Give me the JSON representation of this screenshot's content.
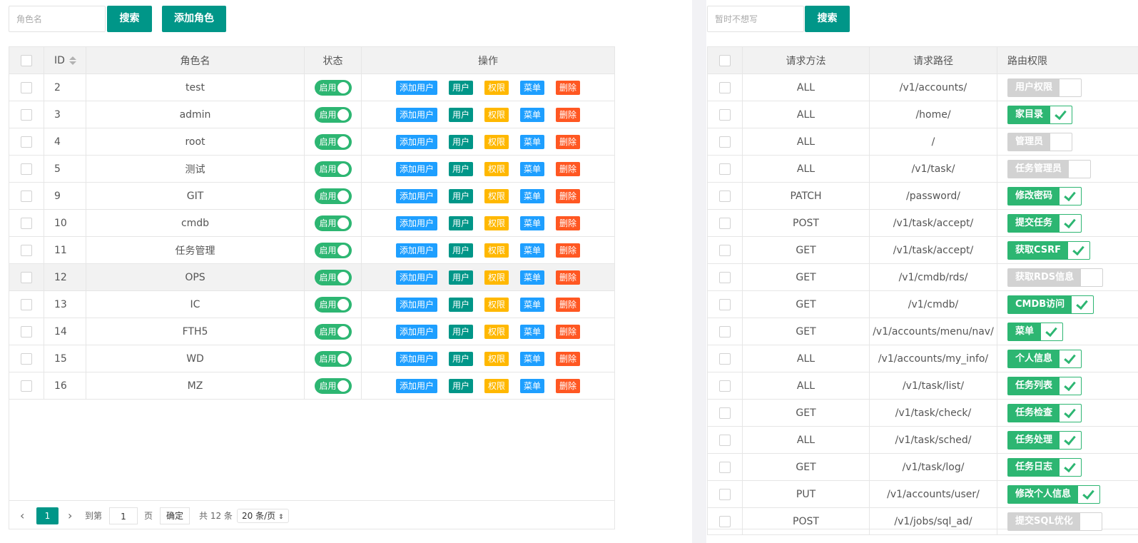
{
  "left": {
    "search_placeholder": "角色名",
    "search_button": "搜索",
    "add_button": "添加角色",
    "columns": {
      "id": "ID",
      "name": "角色名",
      "status": "状态",
      "ops": "操作"
    },
    "status_label": "启用",
    "op_labels": {
      "add_user": "添加用户",
      "user": "用户",
      "perm": "权限",
      "menu": "菜单",
      "delete": "删除"
    },
    "rows": [
      {
        "id": "2",
        "name": "test"
      },
      {
        "id": "3",
        "name": "admin"
      },
      {
        "id": "4",
        "name": "root"
      },
      {
        "id": "5",
        "name": "测试"
      },
      {
        "id": "9",
        "name": "GIT"
      },
      {
        "id": "10",
        "name": "cmdb"
      },
      {
        "id": "11",
        "name": "任务管理"
      },
      {
        "id": "12",
        "name": "OPS",
        "highlight": true
      },
      {
        "id": "13",
        "name": "IC"
      },
      {
        "id": "14",
        "name": "FTH5"
      },
      {
        "id": "15",
        "name": "WD"
      },
      {
        "id": "16",
        "name": "MZ"
      }
    ],
    "pager": {
      "prev": "‹",
      "next": "›",
      "current": "1",
      "goto_label": "到第",
      "goto_value": "1",
      "page_label": "页",
      "confirm": "确定",
      "total": "共 12 条",
      "per_page": "20 条/页"
    }
  },
  "right": {
    "search_placeholder": "暂时不想写",
    "search_button": "搜索",
    "columns": {
      "method": "请求方法",
      "path": "请求路径",
      "perm": "路由权限"
    },
    "rows": [
      {
        "method": "ALL",
        "path": "/v1/accounts/",
        "perm": "用户权限",
        "on": false
      },
      {
        "method": "ALL",
        "path": "/home/",
        "perm": "家目录",
        "on": true
      },
      {
        "method": "ALL",
        "path": "/",
        "perm": "管理员",
        "on": false
      },
      {
        "method": "ALL",
        "path": "/v1/task/",
        "perm": "任务管理员",
        "on": false
      },
      {
        "method": "PATCH",
        "path": "/password/",
        "perm": "修改密码",
        "on": true
      },
      {
        "method": "POST",
        "path": "/v1/task/accept/",
        "perm": "提交任务",
        "on": true
      },
      {
        "method": "GET",
        "path": "/v1/task/accept/",
        "perm": "获取CSRF",
        "on": true
      },
      {
        "method": "GET",
        "path": "/v1/cmdb/rds/",
        "perm": "获取RDS信息",
        "on": false
      },
      {
        "method": "GET",
        "path": "/v1/cmdb/",
        "perm": "CMDB访问",
        "on": true
      },
      {
        "method": "GET",
        "path": "/v1/accounts/menu/nav/",
        "perm": "菜单",
        "on": true
      },
      {
        "method": "ALL",
        "path": "/v1/accounts/my_info/",
        "perm": "个人信息",
        "on": true
      },
      {
        "method": "ALL",
        "path": "/v1/task/list/",
        "perm": "任务列表",
        "on": true
      },
      {
        "method": "GET",
        "path": "/v1/task/check/",
        "perm": "任务检查",
        "on": true
      },
      {
        "method": "ALL",
        "path": "/v1/task/sched/",
        "perm": "任务处理",
        "on": true
      },
      {
        "method": "GET",
        "path": "/v1/task/log/",
        "perm": "任务日志",
        "on": true
      },
      {
        "method": "PUT",
        "path": "/v1/accounts/user/",
        "perm": "修改个人信息",
        "on": true
      },
      {
        "method": "POST",
        "path": "/v1/jobs/sql_ad/",
        "perm": "提交SQL优化",
        "on": false
      }
    ]
  },
  "colors": {
    "primary": "#009688",
    "switch_on": "#2db672",
    "blue": "#1e9fff",
    "orange": "#ffb800",
    "red": "#ff5722"
  }
}
